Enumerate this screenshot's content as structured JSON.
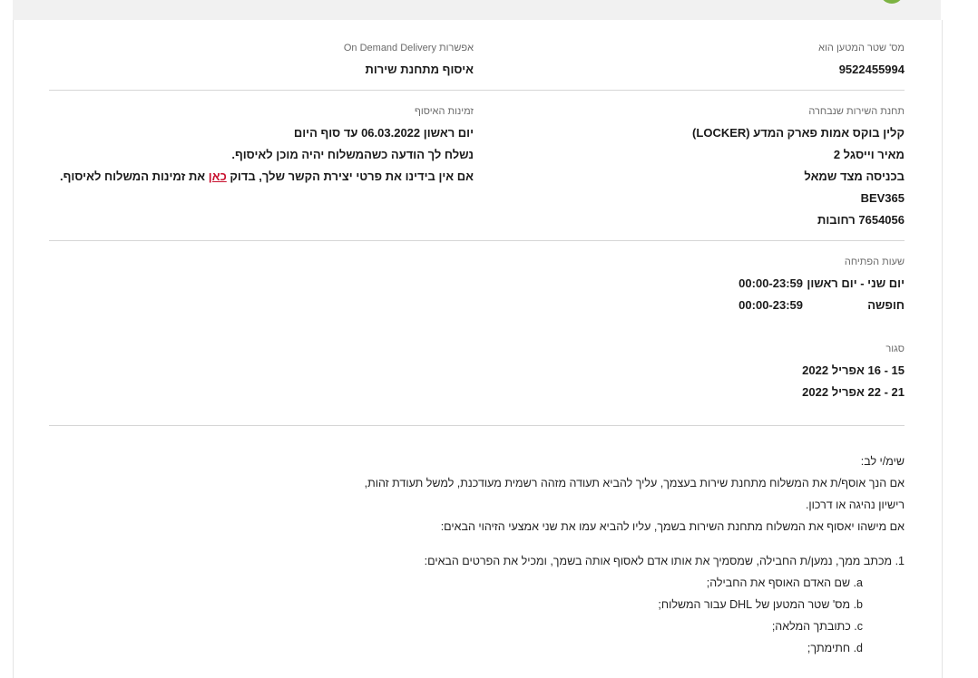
{
  "shipment": {
    "waybill_label": "מס' שטר המטען הוא",
    "waybill_value": "9522455994",
    "delivery_option_label": "אפשרות On Demand Delivery",
    "delivery_option_value": "איסוף מתחנת שירות"
  },
  "service_point": {
    "label": "תחנת השירות שנבחרה",
    "lines": [
      "קלין בוקס אמות פארק המדע (LOCKER)",
      "מאיר וייסגל 2",
      "בכניסה מצד שמאל",
      "BEV365",
      "7654056 רחובות"
    ]
  },
  "pickup": {
    "label": "זמינות האיסוף",
    "date_line": "יום ראשון 06.03.2022 עד סוף היום",
    "notify_line": "נשלח לך הודעה כשהמשלוח יהיה מוכן לאיסוף.",
    "contact_before": "אם אין בידינו את פרטי יצירת הקשר שלך, בדוק ",
    "contact_link": "כאן",
    "contact_after": " את זמינות המשלוח לאיסוף."
  },
  "opening_hours": {
    "label": "שעות הפתיחה",
    "rows": [
      {
        "day": "יום שני - יום ראשון",
        "time": "00:00-23:59"
      },
      {
        "day": "חופשה",
        "time": "00:00-23:59"
      }
    ]
  },
  "closed": {
    "label": "סגור",
    "ranges": [
      "15 - 16 אפריל 2022",
      "21 - 22 אפריל 2022"
    ]
  },
  "notice": {
    "title": "שימ/י לב:",
    "lines": [
      "אם הנך אוסף/ת את המשלוח מתחנת שירות בעצמך, עליך להביא תעודה מזהה רשמית מעודכנת, למשל תעודת זהות,",
      "רישיון נהיגה או דרכון.",
      "אם מישהו יאסוף את המשלוח מתחנת השירות בשמך, עליו להביא עמו את שני אמצעי הזיהוי הבאים:"
    ],
    "step": "1. מכתב ממך, נמען/ת החבילה, שמסמיך את אותו אדם לאסוף אותה בשמך, ומכיל את הפרטים הבאים:",
    "sub_items": [
      "a. שם האדם האוסף את החבילה;",
      "b. מס' שטר המטען של DHL עבור המשלוח;",
      "c. כתובתך המלאה;",
      "d. חתימתך;"
    ]
  },
  "colors": {
    "link": "#c8102e",
    "status_dot": "#7cb342",
    "divider": "#d6d6d6",
    "topbar": "#f1f1f1"
  }
}
